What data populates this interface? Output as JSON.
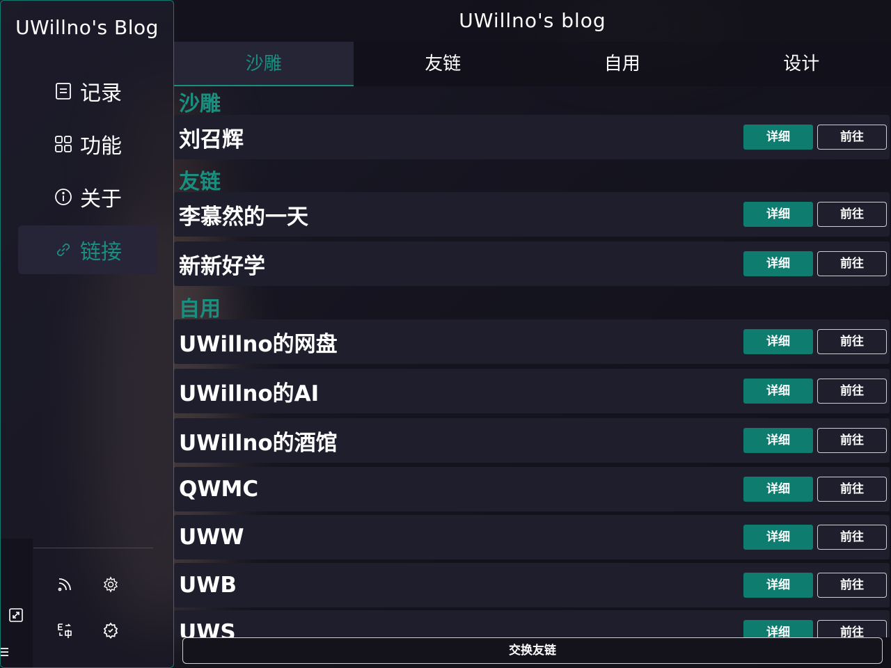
{
  "window": {
    "title": "UWillno's blog"
  },
  "sidebar": {
    "brand": "UWillno's Blog",
    "items": [
      {
        "label": "记录",
        "icon": "document-icon",
        "active": false
      },
      {
        "label": "功能",
        "icon": "grid-icon",
        "active": false
      },
      {
        "label": "关于",
        "icon": "info-icon",
        "active": false
      },
      {
        "label": "链接",
        "icon": "link-icon",
        "active": true
      }
    ],
    "bottom_icons": [
      "rss-icon",
      "settings-icon",
      "translate-icon",
      "settings-badge-icon",
      "expand-icon",
      "menu-icon"
    ]
  },
  "tabs": [
    {
      "label": "沙雕",
      "active": true
    },
    {
      "label": "友链",
      "active": false
    },
    {
      "label": "自用",
      "active": false
    },
    {
      "label": "设计",
      "active": false
    }
  ],
  "sections": [
    {
      "title": "沙雕",
      "items": [
        "刘召辉"
      ]
    },
    {
      "title": "友链",
      "items": [
        "李慕然的一天",
        "新新好学"
      ]
    },
    {
      "title": "自用",
      "items": [
        "UWillno的网盘",
        "UWillno的AI",
        "UWillno的酒馆",
        "QWMC",
        "UWW",
        "UWB",
        "UWS"
      ]
    }
  ],
  "buttons": {
    "detail": "详细",
    "go": "前往",
    "exchange": "交换友链"
  },
  "colors": {
    "accent": "#0f7c70",
    "accent_text": "#1a8f7f",
    "row_bg": "#1f1e2c",
    "page_bg": "#15141f"
  }
}
